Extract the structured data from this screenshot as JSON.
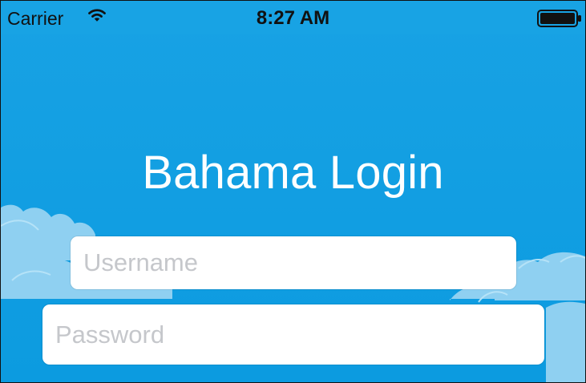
{
  "status_bar": {
    "carrier": "Carrier",
    "time": "8:27 AM"
  },
  "login": {
    "title": "Bahama Login",
    "username_placeholder": "Username",
    "password_placeholder": "Password"
  },
  "colors": {
    "background": "#18a2e4",
    "cloud": "#8fd0f1",
    "text_light": "#ffffff"
  }
}
